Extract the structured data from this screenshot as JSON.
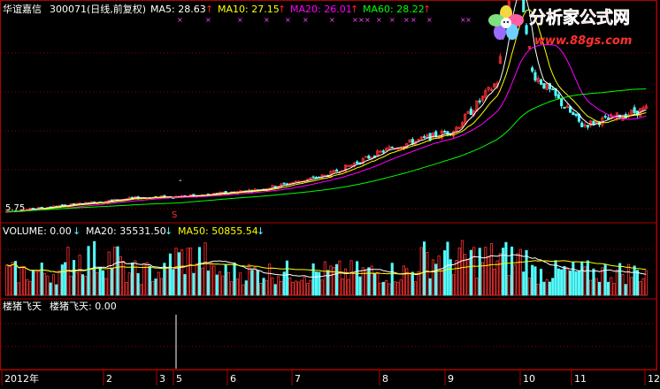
{
  "header": {
    "stock_name": "华谊嘉信",
    "stock_code_info": "300071(日线,前复权)",
    "ma5": {
      "label": "MA5: 28.63",
      "arrow": "↑",
      "color": "#ffffff"
    },
    "ma10": {
      "label": "MA10: 27.15",
      "arrow": "↑",
      "color": "#ffff00"
    },
    "ma20": {
      "label": "MA20: 26.01",
      "arrow": "↑",
      "color": "#ff00ff"
    },
    "ma60": {
      "label": "MA60: 28.22",
      "arrow": "↑",
      "color": "#00ff00"
    }
  },
  "watermark": {
    "brand": "分析家公式网",
    "url": "www.88gs.com"
  },
  "price_panel": {
    "low_label": "5.75",
    "signal_mark": "S",
    "extra_mark": "-"
  },
  "volume_panel": {
    "volume": {
      "label": "VOLUME: 0.00",
      "arrow": "↓",
      "color": "#ffffff"
    },
    "ma20": {
      "label": "MA20: 35531.50",
      "arrow": "↓",
      "color": "#ffffff"
    },
    "ma50": {
      "label": "MA50: 50855.54",
      "arrow": "↓",
      "color": "#ffff00"
    }
  },
  "indicator_panel": {
    "name": "楼猪飞天",
    "value_label": "楼猪飞天: 0.00"
  },
  "colors": {
    "background": "#000000",
    "up": "#ff3232",
    "down": "#54fcfc",
    "grid": "#8b0000",
    "axis": "#b00000"
  },
  "chart_data": [
    {
      "type": "candlestick",
      "name": "price",
      "x_axis_labels": [
        "2012年",
        "2",
        "3",
        "5",
        "6",
        "7",
        "8",
        "9",
        "10",
        "11",
        "12"
      ],
      "annotations": [
        "5.75",
        "S"
      ],
      "ma_lines": [
        {
          "name": "MA5",
          "value": 28.63,
          "color": "#ffffff"
        },
        {
          "name": "MA10",
          "value": 27.15,
          "color": "#ffff00"
        },
        {
          "name": "MA20",
          "value": 26.01,
          "color": "#ff00ff"
        },
        {
          "name": "MA60",
          "value": 28.22,
          "color": "#00ff00"
        }
      ],
      "approx_trend": [
        {
          "month": "2012年",
          "close": 6.0
        },
        {
          "month": "2",
          "close": 7.5
        },
        {
          "month": "3",
          "close": 9.0
        },
        {
          "month": "5",
          "close": 9.5
        },
        {
          "month": "6",
          "close": 11.0
        },
        {
          "month": "7",
          "close": 14.0
        },
        {
          "month": "8",
          "close": 20.0
        },
        {
          "month": "9",
          "close": 24.0
        },
        {
          "month": "10",
          "close": 40.0
        },
        {
          "month": "11",
          "close": 25.0
        },
        {
          "month": "12",
          "close": 28.6
        }
      ]
    },
    {
      "type": "bar",
      "name": "volume",
      "ma_lines": [
        {
          "name": "MA20",
          "value": 35531.5
        },
        {
          "name": "MA50",
          "value": 50855.54
        }
      ]
    },
    {
      "type": "line",
      "name": "楼猪飞天",
      "value": 0.0
    }
  ]
}
